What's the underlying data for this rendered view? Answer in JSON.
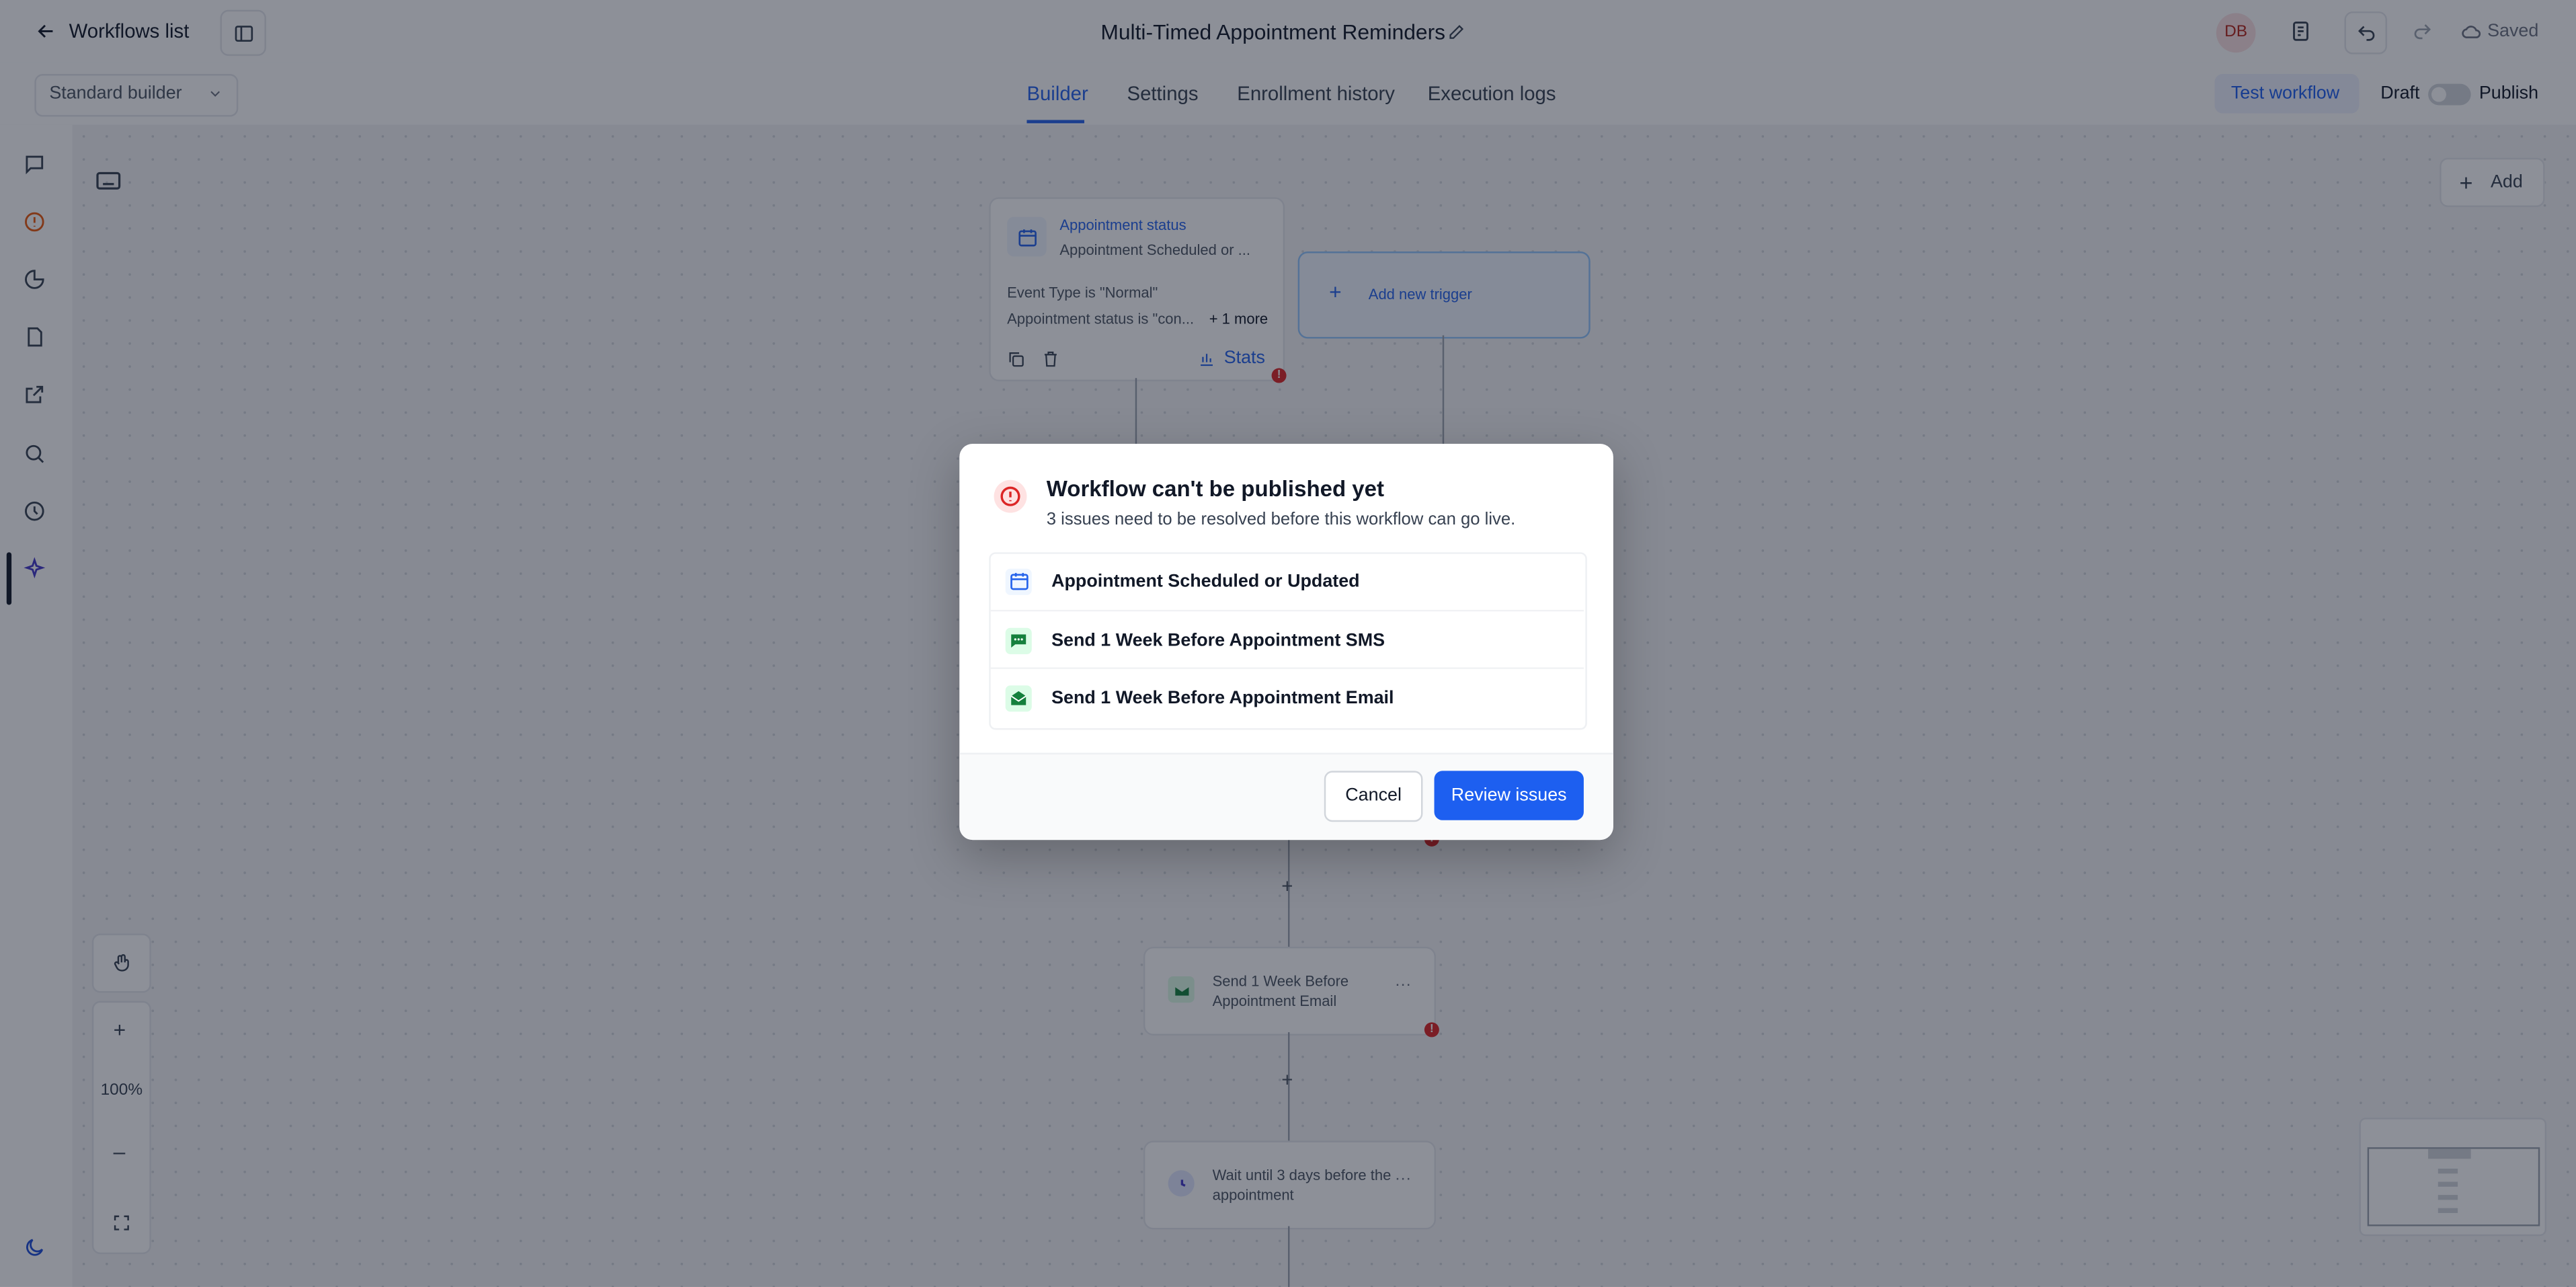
{
  "header": {
    "back_label": "Workflows list",
    "title": "Multi-Timed Appointment Reminders",
    "avatar_initials": "DB",
    "saved_label": "Saved"
  },
  "subbar": {
    "builder_select": "Standard builder",
    "tabs": [
      {
        "label": "Builder",
        "active": true
      },
      {
        "label": "Settings",
        "active": false
      },
      {
        "label": "Enrollment history",
        "active": false
      },
      {
        "label": "Execution logs",
        "active": false
      }
    ],
    "test_workflow": "Test workflow",
    "draft_label": "Draft",
    "publish_label": "Publish"
  },
  "canvas": {
    "add_label": "Add",
    "trigger": {
      "title": "Appointment status",
      "subtitle": "Appointment Scheduled or ...",
      "filter1": "Event Type is \"Normal\"",
      "filter2": "Appointment status is \"con...",
      "more": "+ 1 more",
      "stats": "Stats"
    },
    "add_trigger": "Add new trigger",
    "node_email": "Send 1 Week Before Appointment Email",
    "node_wait": "Wait until 3 days before the appointment",
    "zoom": "100%"
  },
  "modal": {
    "title": "Workflow can't be published yet",
    "subtitle": "3 issues need to be resolved before this workflow can go live.",
    "issues": [
      {
        "label": "Appointment Scheduled or Updated",
        "icon": "calendar-icon"
      },
      {
        "label": "Send 1 Week Before Appointment SMS",
        "icon": "sms-icon"
      },
      {
        "label": "Send 1 Week Before Appointment Email",
        "icon": "email-icon"
      }
    ],
    "cancel_label": "Cancel",
    "review_label": "Review issues"
  },
  "colors": {
    "accent": "#1d5ff0",
    "error": "#dc2626",
    "success": "#15803d"
  }
}
